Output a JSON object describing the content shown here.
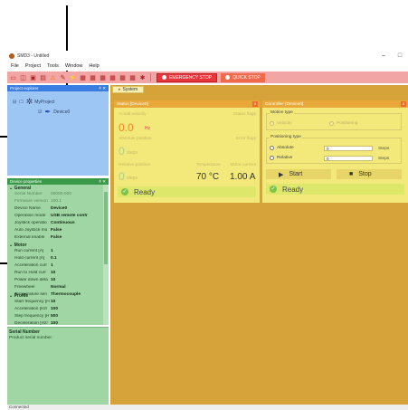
{
  "window": {
    "title": "SMD3 - Untitled",
    "min": "–",
    "max": "□"
  },
  "menu": [
    "File",
    "Project",
    "Tools",
    "Window",
    "Help"
  ],
  "toolbar": {
    "emergency_stop": "EMERGENCY STOP",
    "quick_stop": "QUICK STOP"
  },
  "explorer": {
    "title": "Project explorer",
    "pin": "ǂ ✕",
    "project": "MyProject",
    "device": "Device0"
  },
  "properties": {
    "title": "Device properties",
    "pin": "ǂ ✕",
    "general": "General",
    "rows_general": [
      {
        "k": "Serial Number",
        "v": "00000-000",
        "dim": true
      },
      {
        "k": "Firmware version",
        "v": "100.1",
        "dim": true
      },
      {
        "k": "Device Name",
        "v": "Device0"
      },
      {
        "k": "Operation mode",
        "v": "USB remote contr"
      },
      {
        "k": "Joystick operatio",
        "v": "Continuous"
      },
      {
        "k": "Auto Joystick mo",
        "v": "False"
      },
      {
        "k": "External enable",
        "v": "False"
      }
    ],
    "motor": "Motor",
    "rows_motor": [
      {
        "k": "Run current [A]",
        "v": "1"
      },
      {
        "k": "Hold current [A]",
        "v": "0.1"
      },
      {
        "k": "Acceleration curr",
        "v": "1"
      },
      {
        "k": "Run to Hold curr",
        "v": "10"
      },
      {
        "k": "Power down dela",
        "v": "10"
      },
      {
        "k": "Freewheel",
        "v": "Normal"
      },
      {
        "k": "Temperature sen",
        "v": "Thermocouple"
      }
    ],
    "profile": "Profile",
    "rows_profile": [
      {
        "k": "Start frequency [H",
        "v": "10"
      },
      {
        "k": "Acceleration [Hz/",
        "v": "100"
      },
      {
        "k": "Step frequency [H",
        "v": "500"
      },
      {
        "k": "Deceleration [Hz/",
        "v": "100"
      }
    ],
    "desc_title": "Serial Number",
    "desc_text": "Product serial number."
  },
  "workspace": {
    "tab": "System"
  },
  "status_card": {
    "title": "Status [Device0]",
    "actual_velocity_label": "Actual velocity",
    "status_flags_label": "Status flags",
    "velocity_value": "0.0",
    "velocity_unit": "Hz",
    "abs_pos_label": "Absolute position",
    "error_flags_label": "Error flags",
    "abs_pos_value": "0",
    "abs_pos_unit": "steps",
    "rel_pos_label": "Relative position",
    "temperature_label": "Temperature",
    "motor_current_label": "Motor current",
    "rel_pos_value": "0",
    "rel_pos_unit": "steps",
    "temperature_value": "70 °C",
    "motor_current_value": "1.00 A",
    "ready": "Ready"
  },
  "controller_card": {
    "title": "Controller [Device0]",
    "motion_type": "Motion type",
    "velocity": "Velocity",
    "positioning": "Positioning",
    "positioning_type": "Positioning type",
    "absolute": "Absolute",
    "relative": "Relative",
    "abs_value": "0",
    "rel_value": "0",
    "steps": "Steps",
    "start": "Start",
    "stop": "Stop",
    "ready": "Ready"
  },
  "statusbar": {
    "text": "Connected"
  }
}
